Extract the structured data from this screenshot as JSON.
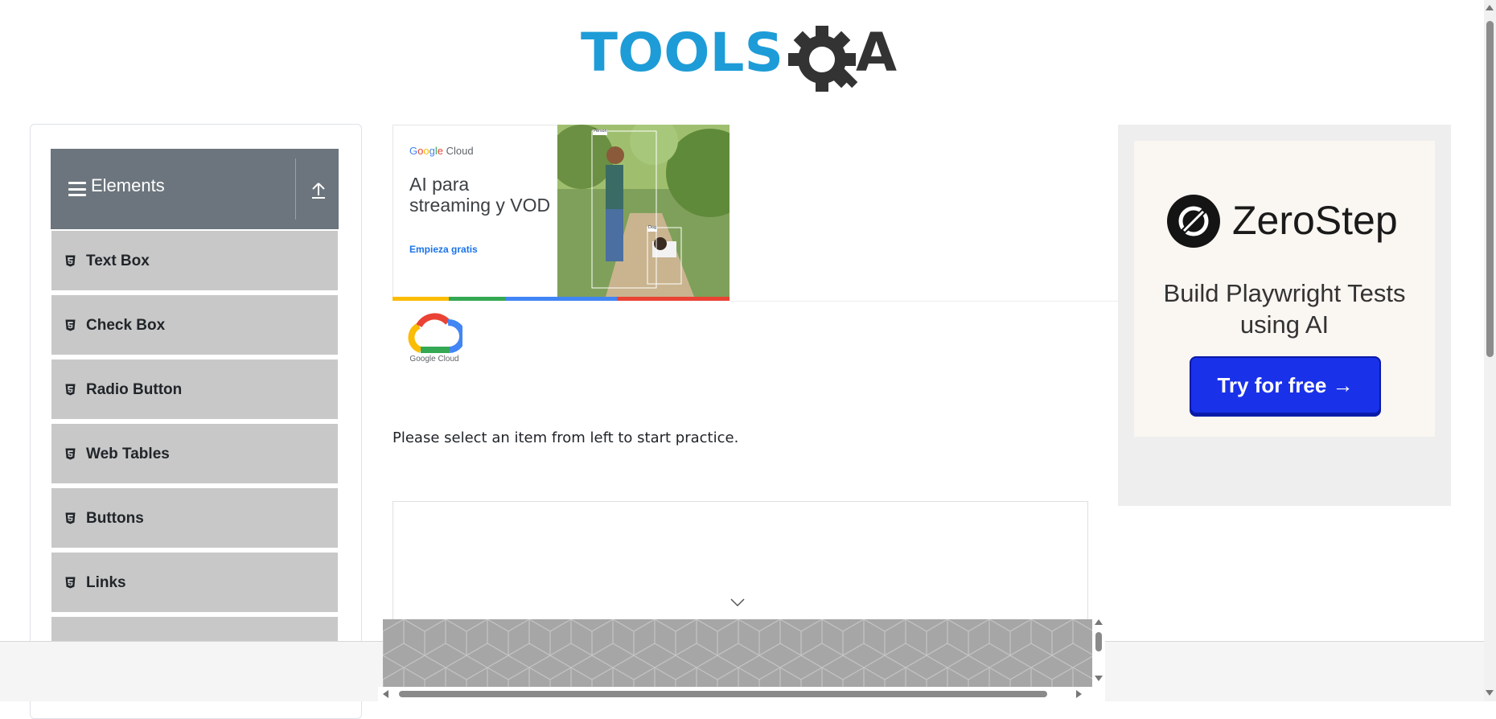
{
  "header": {
    "logo_text": "TOOLSQA",
    "logo_icon": "gear-magnifier-icon"
  },
  "sidebar": {
    "group_title": "Elements",
    "group_icon": "hamburger-icon",
    "collapse_icon": "upload-arrow-icon",
    "item_icon": "html5-icon",
    "items": [
      {
        "label": "Text Box"
      },
      {
        "label": "Check Box"
      },
      {
        "label": "Radio Button"
      },
      {
        "label": "Web Tables"
      },
      {
        "label": "Buttons"
      },
      {
        "label": "Links"
      }
    ]
  },
  "center_ad": {
    "brand": "Google Cloud",
    "headline": "AI para streaming y VOD",
    "cta": "Empieza gratis",
    "photo_label_1": "Person",
    "photo_label_2": "Dog",
    "logo_label": "Google Cloud",
    "bar_colors": [
      "#fbbc05",
      "#34a853",
      "#4285f4",
      "#4285f4",
      "#ea4335",
      "#ea4335"
    ]
  },
  "main": {
    "instruction": "Please select an item from left to start practice."
  },
  "right_ad": {
    "brand": "ZeroStep",
    "tagline": "Build Playwright Tests using AI",
    "button": "Try for free →",
    "button_color": "#1a31ea"
  },
  "colors": {
    "sidebar_header": "#6c757d",
    "menu_item_bg": "#c8c8c8",
    "logo_blue": "#1e9cd7",
    "logo_dark": "#333333"
  }
}
